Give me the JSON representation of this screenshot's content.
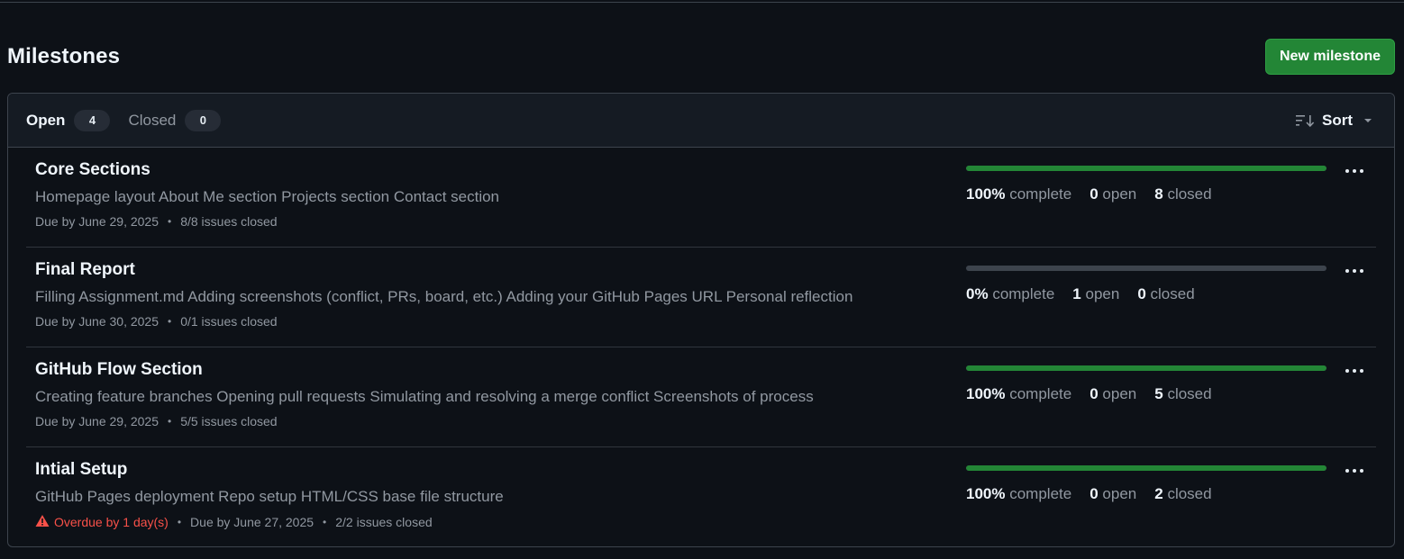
{
  "header": {
    "title": "Milestones",
    "new_button": "New milestone"
  },
  "tabs": [
    {
      "label": "Open",
      "count": "4"
    },
    {
      "label": "Closed",
      "count": "0"
    }
  ],
  "sort_label": "Sort",
  "colors": {
    "progress_fill": "#238636",
    "progress_empty": "#3d444d",
    "overdue": "#f85149",
    "primary_button": "#238636"
  },
  "milestones": [
    {
      "title": "Core Sections",
      "description": "Homepage layout About Me section Projects section Contact section",
      "overdue": "",
      "due": "Due by June 29, 2025",
      "issues": "8/8 issues closed",
      "progress": 1.0,
      "percent": "100%",
      "complete_label": "complete",
      "open_count": "0",
      "open_label": "open",
      "closed_count": "8",
      "closed_label": "closed"
    },
    {
      "title": "Final Report",
      "description": "Filling Assignment.md Adding screenshots (conflict, PRs, board, etc.) Adding your GitHub Pages URL Personal reflection",
      "overdue": "",
      "due": "Due by June 30, 2025",
      "issues": "0/1 issues closed",
      "progress": 0.0,
      "percent": "0%",
      "complete_label": "complete",
      "open_count": "1",
      "open_label": "open",
      "closed_count": "0",
      "closed_label": "closed"
    },
    {
      "title": "GitHub Flow Section",
      "description": "Creating feature branches Opening pull requests Simulating and resolving a merge conflict Screenshots of process",
      "overdue": "",
      "due": "Due by June 29, 2025",
      "issues": "5/5 issues closed",
      "progress": 1.0,
      "percent": "100%",
      "complete_label": "complete",
      "open_count": "0",
      "open_label": "open",
      "closed_count": "5",
      "closed_label": "closed"
    },
    {
      "title": "Intial Setup",
      "description": "GitHub Pages deployment Repo setup HTML/CSS base file structure",
      "overdue": "Overdue by 1 day(s)",
      "due": "Due by June 27, 2025",
      "issues": "2/2 issues closed",
      "progress": 1.0,
      "percent": "100%",
      "complete_label": "complete",
      "open_count": "0",
      "open_label": "open",
      "closed_count": "2",
      "closed_label": "closed"
    }
  ]
}
